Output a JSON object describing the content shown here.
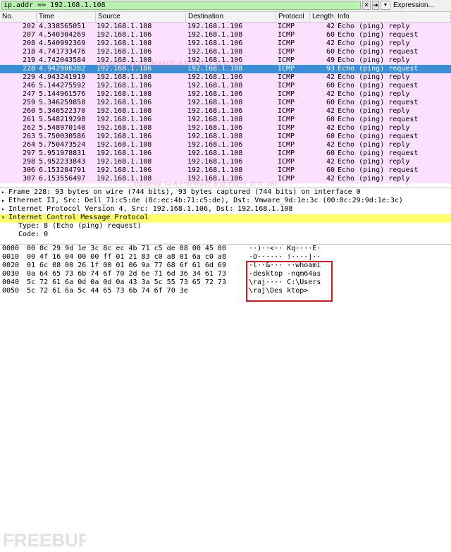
{
  "filter": {
    "value": "ip.addr == 192.168.1.108",
    "clear_glyph": "✕",
    "apply_glyph": "➜",
    "expression_label": "Expression..."
  },
  "columns": [
    "No.",
    "Time",
    "Source",
    "Destination",
    "Protocol",
    "Length",
    "Info"
  ],
  "packets": [
    {
      "no": "202",
      "time": "4.338565051",
      "src": "192.168.1.108",
      "dst": "192.168.1.106",
      "proto": "ICMP",
      "len": "42",
      "info": "Echo (ping) reply"
    },
    {
      "no": "207",
      "time": "4.540304269",
      "src": "192.168.1.106",
      "dst": "192.168.1.108",
      "proto": "ICMP",
      "len": "60",
      "info": "Echo (ping) request"
    },
    {
      "no": "208",
      "time": "4.540992369",
      "src": "192.168.1.108",
      "dst": "192.168.1.106",
      "proto": "ICMP",
      "len": "42",
      "info": "Echo (ping) reply"
    },
    {
      "no": "218",
      "time": "4.741733476",
      "src": "192.168.1.106",
      "dst": "192.168.1.108",
      "proto": "ICMP",
      "len": "60",
      "info": "Echo (ping) request"
    },
    {
      "no": "219",
      "time": "4.742043584",
      "src": "192.168.1.108",
      "dst": "192.168.1.106",
      "proto": "ICMP",
      "len": "49",
      "info": "Echo (ping) reply"
    },
    {
      "no": "228",
      "time": "4.942906282",
      "src": "192.168.1.106",
      "dst": "192.168.1.108",
      "proto": "ICMP",
      "len": "93",
      "info": "Echo (ping) request"
    },
    {
      "no": "229",
      "time": "4.943241919",
      "src": "192.168.1.108",
      "dst": "192.168.1.106",
      "proto": "ICMP",
      "len": "42",
      "info": "Echo (ping) reply"
    },
    {
      "no": "246",
      "time": "5.144275592",
      "src": "192.168.1.106",
      "dst": "192.168.1.108",
      "proto": "ICMP",
      "len": "60",
      "info": "Echo (ping) request"
    },
    {
      "no": "247",
      "time": "5.144961576",
      "src": "192.168.1.108",
      "dst": "192.168.1.106",
      "proto": "ICMP",
      "len": "42",
      "info": "Echo (ping) reply"
    },
    {
      "no": "259",
      "time": "5.346259858",
      "src": "192.168.1.106",
      "dst": "192.168.1.108",
      "proto": "ICMP",
      "len": "60",
      "info": "Echo (ping) request"
    },
    {
      "no": "260",
      "time": "5.346522370",
      "src": "192.168.1.108",
      "dst": "192.168.1.106",
      "proto": "ICMP",
      "len": "42",
      "info": "Echo (ping) reply"
    },
    {
      "no": "261",
      "time": "5.548219298",
      "src": "192.168.1.106",
      "dst": "192.168.1.108",
      "proto": "ICMP",
      "len": "60",
      "info": "Echo (ping) request"
    },
    {
      "no": "262",
      "time": "5.548970140",
      "src": "192.168.1.108",
      "dst": "192.168.1.106",
      "proto": "ICMP",
      "len": "42",
      "info": "Echo (ping) reply"
    },
    {
      "no": "263",
      "time": "5.750030586",
      "src": "192.168.1.106",
      "dst": "192.168.1.108",
      "proto": "ICMP",
      "len": "60",
      "info": "Echo (ping) request"
    },
    {
      "no": "264",
      "time": "5.750473524",
      "src": "192.168.1.108",
      "dst": "192.168.1.106",
      "proto": "ICMP",
      "len": "42",
      "info": "Echo (ping) reply"
    },
    {
      "no": "297",
      "time": "5.951978831",
      "src": "192.168.1.106",
      "dst": "192.168.1.108",
      "proto": "ICMP",
      "len": "60",
      "info": "Echo (ping) request"
    },
    {
      "no": "298",
      "time": "5.952233843",
      "src": "192.168.1.108",
      "dst": "192.168.1.106",
      "proto": "ICMP",
      "len": "42",
      "info": "Echo (ping) reply"
    },
    {
      "no": "306",
      "time": "6.153284791",
      "src": "192.168.1.106",
      "dst": "192.168.1.108",
      "proto": "ICMP",
      "len": "60",
      "info": "Echo (ping) request"
    },
    {
      "no": "307",
      "time": "6.153556497",
      "src": "192.168.1.108",
      "dst": "192.168.1.106",
      "proto": "ICMP",
      "len": "42",
      "info": "Echo (ping) reply"
    }
  ],
  "selected_index": 5,
  "details": [
    {
      "text": "Frame 228: 93 bytes on wire (744 bits), 93 bytes captured (744 bits) on interface 0",
      "expander": "▸",
      "highlight": false,
      "child": false
    },
    {
      "text": "Ethernet II, Src: Dell_71:c5:de (8c:ec:4b:71:c5:de), Dst: Vmware_9d:1e:3c (00:0c:29:9d:1e:3c)",
      "expander": "▸",
      "highlight": false,
      "child": false
    },
    {
      "text": "Internet Protocol Version 4, Src: 192.168.1.106, Dst: 192.168.1.108",
      "expander": "▸",
      "highlight": false,
      "child": false
    },
    {
      "text": "Internet Control Message Protocol",
      "expander": "▾",
      "highlight": true,
      "child": false
    },
    {
      "text": "Type: 8 (Echo (ping) request)",
      "expander": "",
      "highlight": false,
      "child": true
    },
    {
      "text": "Code: 0",
      "expander": "",
      "highlight": false,
      "child": true
    }
  ],
  "bytes": [
    {
      "offset": "0000",
      "hex": "00 0c 29 9d 1e 3c 8c ec  4b 71 c5 de 08 00 45 00",
      "ascii": "··)··<·· Kq····E·"
    },
    {
      "offset": "0010",
      "hex": "00 4f 16 04 00 00 ff 01  21 83 c0 a8 01 6a c0 a8",
      "ascii": "·O······ !····j··"
    },
    {
      "offset": "0020",
      "hex": "01 6c 08 00 26 1f 00 01  06 9a 77 68 6f 61 6d 69",
      "ascii": "·l··&··· ··whoami"
    },
    {
      "offset": "0030",
      "hex": "0a 64 65 73 6b 74 6f 70  2d 6e 71 6d 36 34 61 73",
      "ascii": "·desktop -nqm64as"
    },
    {
      "offset": "0040",
      "hex": "5c 72 61 6a 0d 0a 0d 0a  43 3a 5c 55 73 65 72 73",
      "ascii": "\\raj···· C:\\Users"
    },
    {
      "offset": "0050",
      "hex": "5c 72 61 6a 5c 44 65 73  6b 74 6f 70 3e",
      "ascii": "\\raj\\Des ktop>"
    }
  ],
  "watermarks": {
    "top": "WWW.HACKINGARTICLES.IN",
    "bottom": "WWW.HACKINGARTICLES.IN",
    "logo": "FREEBUF"
  }
}
